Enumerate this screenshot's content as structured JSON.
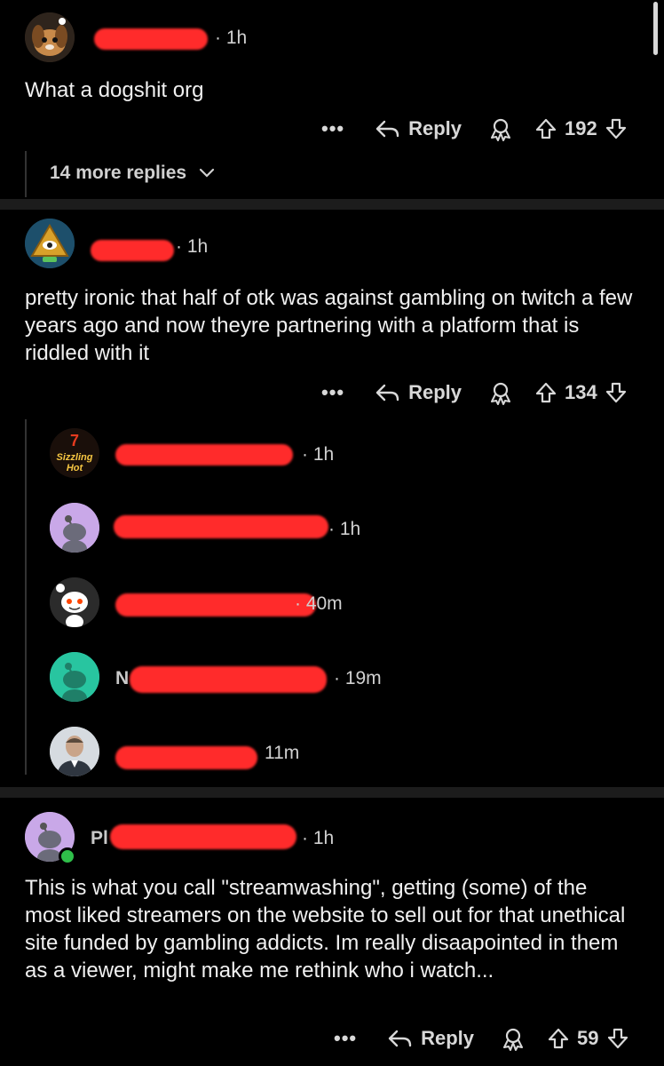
{
  "comments": [
    {
      "time": "· 1h",
      "body": "What a dogshit org",
      "actions": {
        "more": "•••",
        "reply": "Reply",
        "votes": "192"
      },
      "more_replies": "14 more replies"
    },
    {
      "time": "· 1h",
      "body": "pretty ironic that half of otk was against gambling on twitch a few years ago and now theyre partnering with a platform that is riddled with it",
      "actions": {
        "more": "•••",
        "reply": "Reply",
        "votes": "134"
      },
      "replies": [
        {
          "time": "· 1h",
          "avatar_text": "Sizzling Hot"
        },
        {
          "time": "· 1h"
        },
        {
          "time": "· 40m"
        },
        {
          "prefix": "N",
          "time": "· 19m"
        },
        {
          "time": "11m"
        }
      ]
    },
    {
      "prefix": "Pl",
      "time": "· 1h",
      "body": "This is what you call \"streamwashing\", getting (some) of the most liked streamers on the website to sell out for that unethical site funded by gambling addicts. Im really disaapointed in them as a viewer, might make me rethink who i watch...",
      "actions": {
        "more": "•••",
        "reply": "Reply",
        "votes": "59"
      }
    }
  ]
}
